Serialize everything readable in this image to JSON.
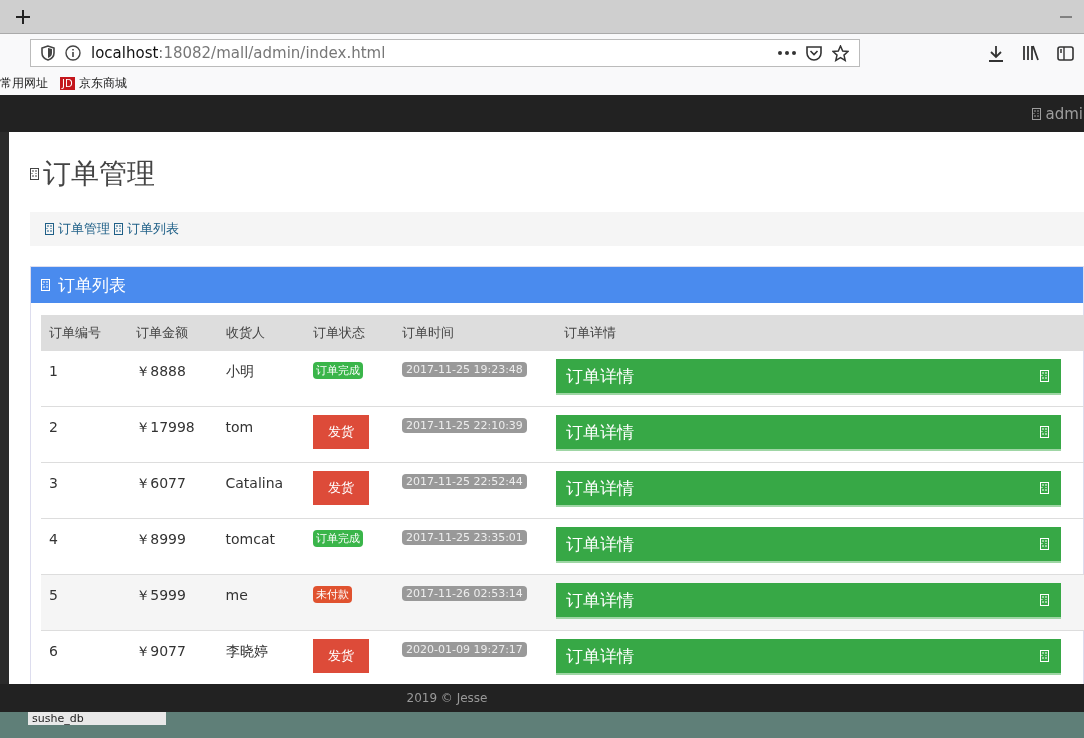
{
  "browser": {
    "url_host": "localhost",
    "url_path": ":18082/mall/admin/index.html",
    "bookmarks": [
      {
        "kind": "folder",
        "label": "常用网址"
      },
      {
        "kind": "site",
        "badge": "JD",
        "label": "京东商城"
      }
    ]
  },
  "navbar": {
    "user": "admi"
  },
  "page": {
    "title": "订单管理",
    "breadcrumb": [
      "订单管理",
      "订单列表"
    ]
  },
  "panel": {
    "title": "订单列表",
    "columns": [
      "订单编号",
      "订单金额",
      "收货人",
      "订单状态",
      "订单时间",
      "订单详情"
    ],
    "rows": [
      {
        "id": "1",
        "amount": "￥8888",
        "receiver": "小明",
        "status": {
          "kind": "badge-done",
          "label": "订单完成"
        },
        "time": "2017-11-25 19:23:48",
        "detail": "订单详情",
        "highlighted": false
      },
      {
        "id": "2",
        "amount": "￥17998",
        "receiver": "tom",
        "status": {
          "kind": "ship-button",
          "label": "发货"
        },
        "time": "2017-11-25 22:10:39",
        "detail": "订单详情",
        "highlighted": false
      },
      {
        "id": "3",
        "amount": "￥6077",
        "receiver": "Catalina",
        "status": {
          "kind": "ship-button",
          "label": "发货"
        },
        "time": "2017-11-25 22:52:44",
        "detail": "订单详情",
        "highlighted": false
      },
      {
        "id": "4",
        "amount": "￥8999",
        "receiver": "tomcat",
        "status": {
          "kind": "badge-done",
          "label": "订单完成"
        },
        "time": "2017-11-25 23:35:01",
        "detail": "订单详情",
        "highlighted": false
      },
      {
        "id": "5",
        "amount": "￥5999",
        "receiver": "me",
        "status": {
          "kind": "badge-unpaid",
          "label": "未付款"
        },
        "time": "2017-11-26 02:53:14",
        "detail": "订单详情",
        "highlighted": true
      },
      {
        "id": "6",
        "amount": "￥9077",
        "receiver": "李晓婷",
        "status": {
          "kind": "ship-button",
          "label": "发货"
        },
        "time": "2020-01-09 19:27:17",
        "detail": "订单详情",
        "highlighted": false
      }
    ]
  },
  "footer": {
    "text": "2019 © Jesse"
  },
  "taskbar": {
    "item": "sushe_db"
  }
}
